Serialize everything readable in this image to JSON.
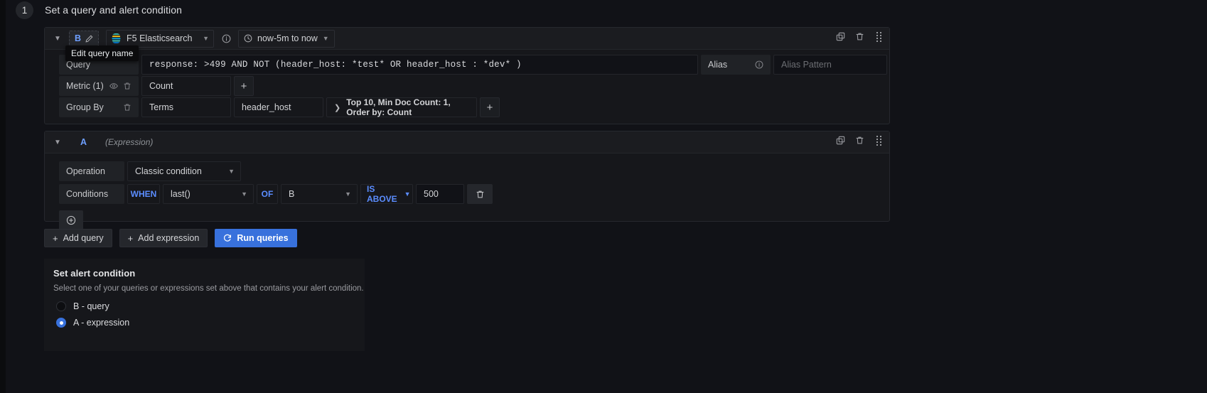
{
  "step": {
    "number": "1",
    "title": "Set a query and alert condition"
  },
  "tooltip": "Edit query name",
  "query_b": {
    "ref_id": "B",
    "datasource": "F5 Elasticsearch",
    "time_range": "now-5m to now",
    "query_label": "Query",
    "query_value": "response: >499 AND NOT (header_host: *test* OR header_host : *dev* )",
    "alias_label": "Alias",
    "alias_placeholder": "Alias Pattern",
    "metric_label": "Metric (1)",
    "metric_value": "Count",
    "metric_add": "+",
    "groupby_label": "Group By",
    "groupby_type": "Terms",
    "groupby_field": "header_host",
    "groupby_settings": "Top 10, Min Doc Count: 1, Order by: Count",
    "groupby_add": "+"
  },
  "expression_a": {
    "ref_id": "A",
    "kind": "(Expression)",
    "operation_label": "Operation",
    "operation_value": "Classic condition",
    "conditions_label": "Conditions",
    "when_keyword": "WHEN",
    "reducer": "last()",
    "of_keyword": "OF",
    "of_value": "B",
    "evaluator": "IS ABOVE",
    "threshold": "500"
  },
  "actions": {
    "add_query": "Add query",
    "add_expression": "Add expression",
    "run_queries": "Run queries",
    "plus_glyph": "+"
  },
  "alert_condition": {
    "title": "Set alert condition",
    "description": "Select one of your queries or expressions set above that contains your alert condition.",
    "options": [
      {
        "label": "B - query",
        "selected": false
      },
      {
        "label": "A - expression",
        "selected": true
      }
    ]
  },
  "colors": {
    "accent": "#3871dc",
    "refid": "#6e9fff",
    "keyword": "#5b8dff",
    "panel": "#16171b",
    "background": "#111217"
  }
}
